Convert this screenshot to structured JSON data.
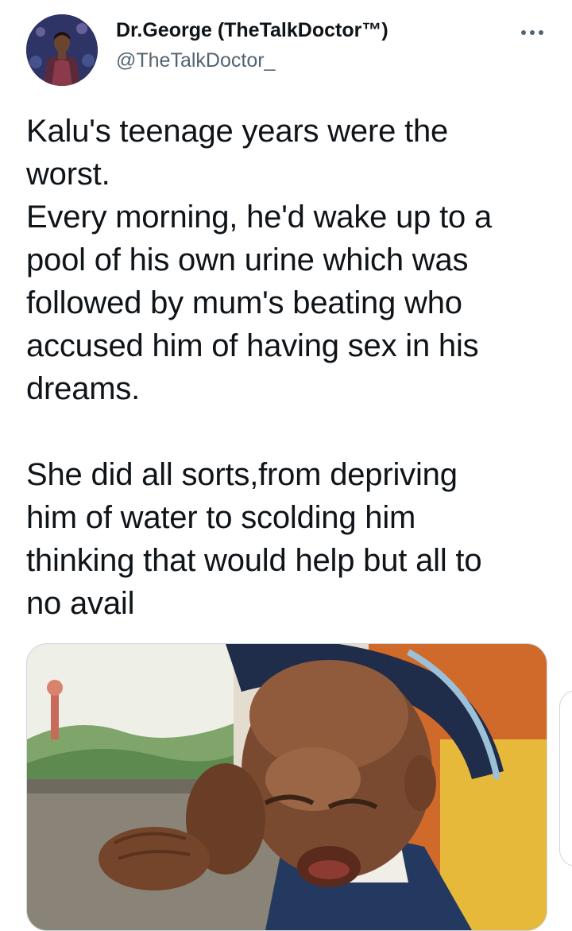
{
  "tweet": {
    "author_name": "Dr.George (TheTalkDoctor™)",
    "author_handle": "@TheTalkDoctor_",
    "paragraphs": [
      "Kalu's teenage years were the worst.\nEvery morning, he'd wake up to a pool of his own urine which was followed by mum's beating who accused him of having sex in his dreams.",
      "She did all sorts,from depriving him of water to scolding him thinking that would help but all to no avail"
    ],
    "lines_p1": [
      "Kalu's teenage years were the",
      "worst.",
      "Every morning, he'd wake up to a",
      "pool of his own urine which was",
      "followed by mum's beating who",
      "accused him of having sex in his",
      "dreams."
    ],
    "lines_p2": [
      "She did all sorts,from depriving",
      "him of water to scolding him",
      "thinking that would help but all to",
      "no avail"
    ]
  },
  "icons": {
    "more": "more-horizontal-icon"
  },
  "colors": {
    "text_primary": "#0f1419",
    "text_secondary": "#536471",
    "border": "#cfd9de"
  }
}
